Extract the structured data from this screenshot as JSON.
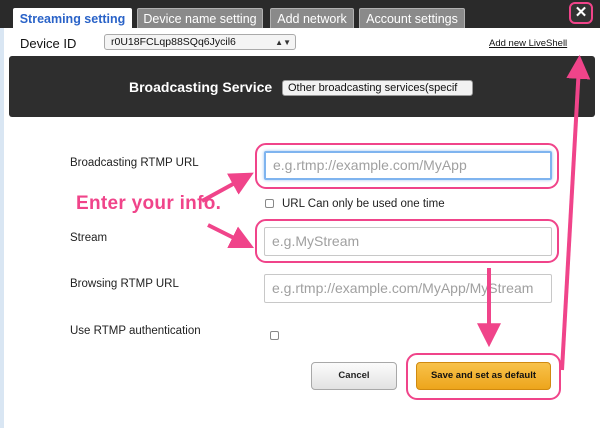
{
  "tabs": [
    {
      "label": "Streaming setting",
      "active": true
    },
    {
      "label": "Device name setting",
      "active": false
    },
    {
      "label": "Add network",
      "active": false
    },
    {
      "label": "Account settings",
      "active": false
    }
  ],
  "close_label": "✕",
  "device": {
    "label": "Device ID",
    "selected_value": "r0U18FCLqp88SQq6Jycil6",
    "add_link": "Add new LiveShell"
  },
  "broadcasting": {
    "label": "Broadcasting Service",
    "selected_value": "Other broadcasting services(specif"
  },
  "form": {
    "rtmp_url_label": "Broadcasting RTMP URL",
    "rtmp_url_placeholder": "e.g.rtmp://example.com/MyApp",
    "url_once_label": "URL Can only be used one time",
    "stream_label": "Stream",
    "stream_placeholder": "e.g.MyStream",
    "browsing_label": "Browsing RTMP URL",
    "browsing_placeholder": "e.g.rtmp://example.com/MyApp/MyStream",
    "auth_label": "Use RTMP authentication"
  },
  "annotation": "Enter your info.",
  "buttons": {
    "cancel": "Cancel",
    "save": "Save and set as default"
  },
  "colors": {
    "highlight": "#f0448a",
    "save_button": "#f0b030",
    "active_tab_text": "#2a63c8"
  }
}
